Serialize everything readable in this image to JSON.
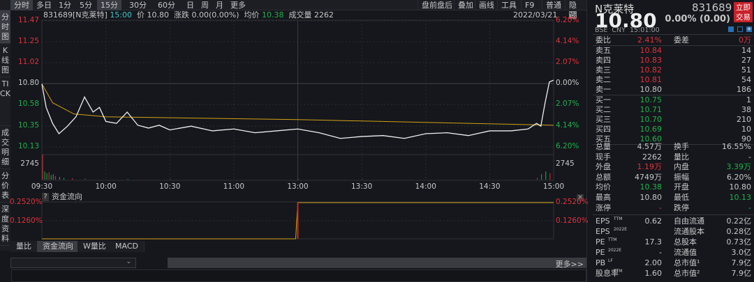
{
  "period_tabs": [
    "分时",
    "多日",
    "1分",
    "5分",
    "15分",
    "30分",
    "60分",
    "日",
    "周",
    "月",
    "更多"
  ],
  "tools": [
    "盘前盘后",
    "叠加",
    "画线",
    "工具",
    "F9",
    "普通",
    "隐藏"
  ],
  "left_tabs": [
    "分时图",
    "K线图",
    "TICK",
    "成交明细",
    "分价表",
    "深度资料"
  ],
  "info": {
    "code_name": "831689[N克莱特]",
    "time": "15:00",
    "price_label": "价",
    "price": "10.80",
    "change_label": "涨跌",
    "change": "0.00(0.00%)",
    "avg_label": "均价",
    "avg": "10.38",
    "vol_label": "成交量",
    "vol": "2262",
    "date": "2022/03/21"
  },
  "axis": {
    "left": [
      "11.47",
      "11.25",
      "11.02",
      "10.80",
      "10.58",
      "10.35",
      "10.13",
      "2745"
    ],
    "right": [
      "6.20%",
      "4.14%",
      "2.07%",
      "0.00%",
      "2.07%",
      "4.14%",
      "6.20%",
      "2745"
    ],
    "times": [
      "09:30",
      "10:00",
      "10:30",
      "11:00",
      "13:00",
      "13:30",
      "14:00",
      "14:30",
      "15:00"
    ]
  },
  "chart_data": {
    "type": "line",
    "title": "831689 intraday",
    "ylim": [
      10.13,
      11.47
    ],
    "prev_close": 10.8,
    "price": [
      [
        0,
        10.8
      ],
      [
        2,
        10.55
      ],
      [
        5,
        10.38
      ],
      [
        8,
        10.27
      ],
      [
        12,
        10.35
      ],
      [
        16,
        10.45
      ],
      [
        20,
        10.66
      ],
      [
        24,
        10.5
      ],
      [
        27,
        10.55
      ],
      [
        30,
        10.4
      ],
      [
        35,
        10.38
      ],
      [
        40,
        10.5
      ],
      [
        45,
        10.36
      ],
      [
        50,
        10.33
      ],
      [
        55,
        10.36
      ],
      [
        60,
        10.31
      ],
      [
        70,
        10.35
      ],
      [
        80,
        10.3
      ],
      [
        90,
        10.32
      ],
      [
        100,
        10.28
      ],
      [
        110,
        10.3
      ],
      [
        120,
        10.32
      ],
      [
        130,
        10.28
      ],
      [
        140,
        10.22
      ],
      [
        150,
        10.24
      ],
      [
        160,
        10.25
      ],
      [
        170,
        10.22
      ],
      [
        180,
        10.27
      ],
      [
        190,
        10.28
      ],
      [
        200,
        10.25
      ],
      [
        210,
        10.3
      ],
      [
        220,
        10.3
      ],
      [
        228,
        10.32
      ],
      [
        232,
        10.38
      ],
      [
        234,
        10.35
      ],
      [
        236,
        10.6
      ],
      [
        238,
        10.82
      ],
      [
        240,
        10.84
      ]
    ],
    "avg": [
      [
        0,
        10.8
      ],
      [
        5,
        10.6
      ],
      [
        15,
        10.48
      ],
      [
        30,
        10.45
      ],
      [
        120,
        10.42
      ],
      [
        240,
        10.36
      ]
    ],
    "volume": [
      [
        0,
        2745
      ],
      [
        1,
        900
      ],
      [
        2,
        700
      ],
      [
        3,
        800
      ],
      [
        4,
        500
      ],
      [
        5,
        600
      ],
      [
        6,
        400
      ],
      [
        8,
        300
      ],
      [
        10,
        200
      ],
      [
        14,
        150
      ],
      [
        20,
        120
      ],
      [
        40,
        80
      ],
      [
        60,
        60
      ],
      [
        120,
        60
      ],
      [
        150,
        50
      ],
      [
        232,
        200
      ],
      [
        234,
        600
      ],
      [
        236,
        900
      ],
      [
        238,
        700
      ]
    ]
  },
  "fund": {
    "title": "资金流向",
    "help": "?",
    "top": "0.2520%",
    "mid": "0.1260%",
    "series": [
      [
        0,
        0
      ],
      [
        119,
        0
      ],
      [
        120,
        0.252
      ],
      [
        240,
        0.252
      ]
    ]
  },
  "bottom_tabs": [
    "量比",
    "资金流向",
    "W量比",
    "MACD"
  ],
  "more": "更多>>",
  "quote": {
    "name": "N克莱特",
    "code": "831689",
    "price": "10.80",
    "change": "0.00% (0.00)",
    "trade_btn": "立即交易",
    "meta": "BSE  CNY  15:01:00",
    "wb_label": "委比",
    "wb": "2.41%",
    "wc_label": "委差",
    "wc": "0万",
    "asks": [
      {
        "l": "卖五",
        "p": "10.84",
        "v": "14"
      },
      {
        "l": "卖四",
        "p": "10.83",
        "v": "27"
      },
      {
        "l": "卖三",
        "p": "10.82",
        "v": "51"
      },
      {
        "l": "卖二",
        "p": "10.81",
        "v": "54"
      },
      {
        "l": "卖一",
        "p": "10.80",
        "v": "186"
      }
    ],
    "bids": [
      {
        "l": "买一",
        "p": "10.75",
        "v": "1"
      },
      {
        "l": "买二",
        "p": "10.71",
        "v": "38"
      },
      {
        "l": "买三",
        "p": "10.70",
        "v": "210"
      },
      {
        "l": "买四",
        "p": "10.69",
        "v": "10"
      },
      {
        "l": "买五",
        "p": "10.60",
        "v": "90"
      }
    ],
    "stats": [
      [
        "总量",
        "4.57万",
        "",
        "换手",
        "16.55%",
        ""
      ],
      [
        "现手",
        "2262",
        "",
        "量比",
        "-",
        ""
      ],
      [
        "外盘",
        "1.19万",
        "red",
        "内盘",
        "3.39万",
        "green"
      ],
      [
        "总额",
        "4749万",
        "",
        "振幅",
        "6.20%",
        ""
      ],
      [
        "均价",
        "10.38",
        "green",
        "开盘",
        "10.80",
        ""
      ],
      [
        "最高",
        "10.80",
        "",
        "最低",
        "10.13",
        "green"
      ],
      [
        "涨停",
        "-",
        "red",
        "跌停",
        "-",
        "green"
      ]
    ],
    "fin": [
      [
        "EPS",
        "TTM",
        "0.62",
        "自由流通",
        "0.22亿"
      ],
      [
        "EPS",
        "2022E",
        "",
        "流通股本",
        "0.28亿"
      ],
      [
        "PE",
        "TTM",
        "17.3",
        "总股本",
        "0.73亿"
      ],
      [
        "PE",
        "2022E",
        "-",
        "流通值",
        "3.0亿"
      ],
      [
        "PB",
        "LF",
        "2.00",
        "总市值¹",
        "7.9亿"
      ],
      [
        "股息率",
        "TTM",
        "1.60",
        "总市值²",
        "7.9亿"
      ]
    ]
  }
}
